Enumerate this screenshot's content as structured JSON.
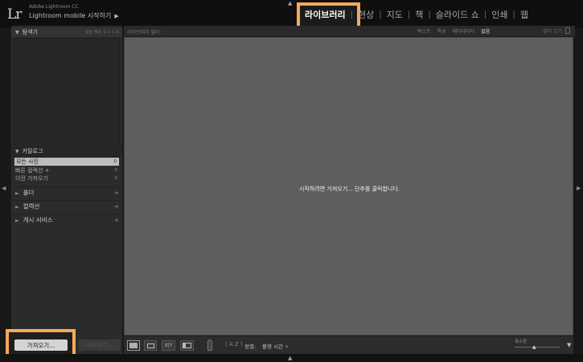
{
  "app": {
    "logo": "Lr",
    "brand": "Adobe Lightroom CC",
    "mobile_label": "Lightroom mobile 시작하기",
    "mobile_arrow": "▶"
  },
  "modules": {
    "active": "라이브러리",
    "items": [
      "현상",
      "지도",
      "책",
      "슬라이드 쇼",
      "인쇄",
      "웹"
    ],
    "separator": "|"
  },
  "navigator": {
    "label": "탐색기",
    "zoom_options": "맞춤  채움  1:1  1:4"
  },
  "catalog": {
    "label": "카탈로그",
    "items": [
      {
        "label": "모든 사진",
        "count": "0",
        "selected": true
      },
      {
        "label": "빠른 컬렉션 +",
        "count": "0",
        "selected": false
      },
      {
        "label": "이전 가져오기",
        "count": "0",
        "selected": false
      }
    ]
  },
  "sections": {
    "folders": "폴더",
    "collections": "컬렉션",
    "publish": "게시 서비스",
    "plus": "+"
  },
  "filter": {
    "title": "라이브러리 필터 :",
    "options": [
      "텍스트",
      "특성",
      "메타데이터",
      "없음"
    ],
    "active": "없음",
    "right_label": "필터 끄기"
  },
  "main": {
    "empty_message": "시작하려면 가져오기... 단추를 클릭합니다."
  },
  "toolbar": {
    "sort_label": "정렬:",
    "sort_value": "촬영 시간 ÷",
    "thumbnail_label": "축소판",
    "compare_glyph": "X|Y",
    "sort_dir_glyph": "( A Z )"
  },
  "buttons": {
    "import": "가져오기...",
    "export": "내보내기..."
  },
  "glyphs": {
    "triangle_down": "▼",
    "triangle_right": "►",
    "collapse_up": "▲",
    "collapse_down": "▲",
    "edge_left": "◀",
    "edge_right": "▶",
    "menu_down": "▼",
    "slider_knob": "▲"
  },
  "colors": {
    "highlight": "#f7a85a",
    "background": "#1a1a1a",
    "grid": "#5e5e5e"
  }
}
